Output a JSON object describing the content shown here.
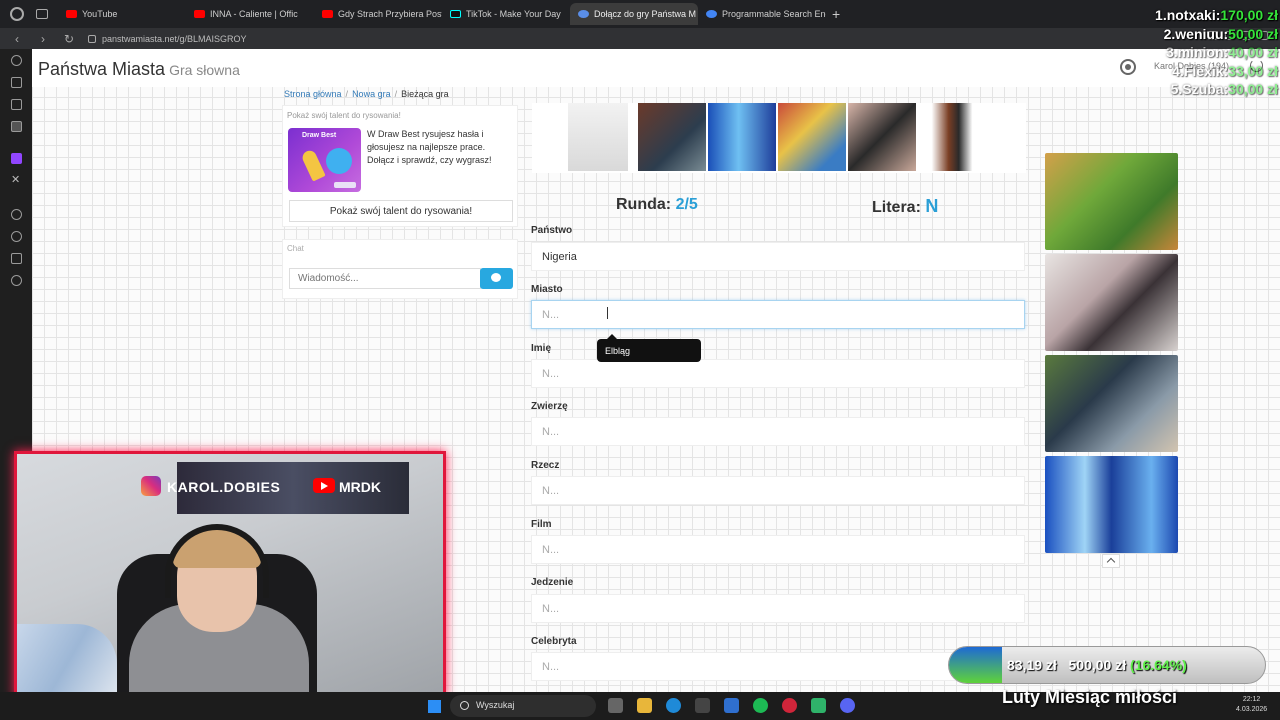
{
  "browser": {
    "tabs": [
      {
        "label": "YouTube",
        "color": "#ff0000",
        "active": false
      },
      {
        "label": "INNA - Caliente | Offic",
        "color": "#ff0000",
        "active": false
      },
      {
        "label": "Gdy Strach Przybiera Post",
        "color": "#ff0000",
        "active": false
      },
      {
        "label": "TikTok - Make Your Day",
        "color": "#111111",
        "active": false
      },
      {
        "label": "Dołącz do gry Państwa M",
        "color": "#5a8ee8",
        "active": true
      },
      {
        "label": "Programmable Search Eng",
        "color": "#4285f4",
        "active": false
      }
    ],
    "new_tab": "+",
    "url": "panstwamiasta.net/g/BLMAISGROY"
  },
  "site": {
    "title": "Państwa Miasta",
    "subtitle": "Gra słowna",
    "user": "Karol Dobies (194)"
  },
  "breadcrumb": {
    "home": "Strona główna",
    "new_game": "Nowa gra",
    "current": "Bieżąca gra"
  },
  "promo": {
    "heading": "Pokaż swój talent do rysowania!",
    "image_title": "Draw Best",
    "text": "W Draw Best rysujesz hasła i głosujesz na najlepsze prace. Dołącz i sprawdź, czy wygrasz!",
    "button": "Pokaż swój talent do rysowania!"
  },
  "chat": {
    "label": "Chat",
    "placeholder": "Wiadomość..."
  },
  "game": {
    "round_label": "Runda:",
    "round_value": "2/5",
    "letter_label": "Litera:",
    "letter_value": "N"
  },
  "fields": [
    {
      "label": "Państwo",
      "value": "Nigeria",
      "placeholder": "N..."
    },
    {
      "label": "Miasto",
      "value": "",
      "placeholder": "N..."
    },
    {
      "label": "Imię",
      "value": "",
      "placeholder": "N..."
    },
    {
      "label": "Zwierzę",
      "value": "",
      "placeholder": "N..."
    },
    {
      "label": "Rzecz",
      "value": "",
      "placeholder": "N..."
    },
    {
      "label": "Film",
      "value": "",
      "placeholder": "N..."
    },
    {
      "label": "Jedzenie",
      "value": "",
      "placeholder": "N..."
    },
    {
      "label": "Celebryta",
      "value": "",
      "placeholder": "N..."
    }
  ],
  "tooltip": "Elbląg",
  "stream": {
    "instagram": "KAROL.DOBIES",
    "youtube": "MRDK",
    "donations": [
      {
        "name": "1.notxaki:",
        "amount": "170,00 zł"
      },
      {
        "name": "2.weniuu:",
        "amount": "50,00 zł"
      },
      {
        "name": "3.minion:",
        "amount": "40,00 zł"
      },
      {
        "name": "4.Flexik:",
        "amount": "33,00 zł"
      },
      {
        "name": "5.Szuba:",
        "amount": "30,00 zł"
      }
    ],
    "goal": {
      "current": "83,19 zł",
      "target": "500,00 zł",
      "percent_text": "(16.64%)",
      "fraction": 0.1664,
      "title": "Luty Miesiąc miłości"
    }
  },
  "taskbar": {
    "search": "Wyszukaj",
    "time": "22:12",
    "date": "4.03.2026"
  }
}
